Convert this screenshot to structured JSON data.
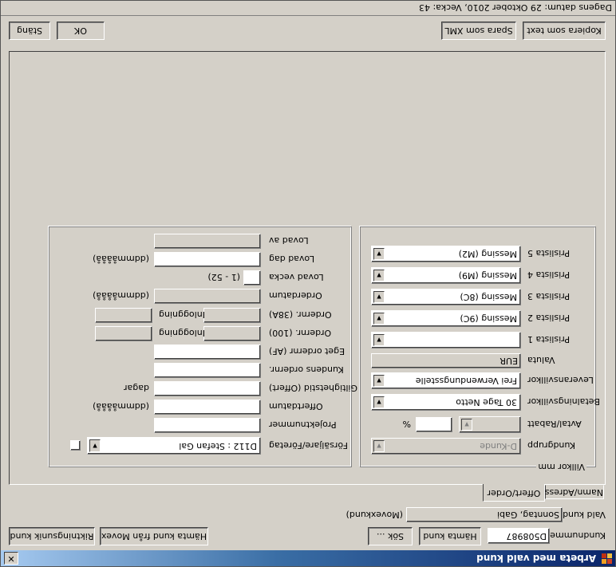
{
  "window": {
    "title": "Arbeta med vald kund",
    "close_glyph": "✕"
  },
  "top": {
    "kundnummer_label": "Kundnummer",
    "kundnummer_value": "D508987",
    "hamta_kund": "Hämta kund",
    "sok": "Sök ...",
    "hamta_movex": "Hämta kund från Movex",
    "riktningsunik": "Riktningsunik kund",
    "vald_kund_label": "Vald kund",
    "vald_kund_value": "Sonntag, Gabi",
    "movexkund": "(Movexkund)"
  },
  "tabs": {
    "namn_adress": "Namn/Adress",
    "offert_order": "Offert/Order"
  },
  "villkor": {
    "legend": "Villkor mm",
    "kundgrupp_label": "Kundgrupp",
    "kundgrupp_value": "D-Kunde",
    "avtal_label": "Avtal/Rabatt",
    "avtal_value": "",
    "percent": "%",
    "betalning_label": "Betalningsvillkor",
    "betalning_value": "30 Tage Netto",
    "leverans_label": "Leveransvillkor",
    "leverans_value": "Frei Verwendungsstelle",
    "valuta_label": "Valuta",
    "valuta_value": "EUR",
    "prislista1_label": "Prislista 1",
    "prislista1_value": "",
    "prislista2_label": "Prislista 2",
    "prislista2_value": "Messing (9C)",
    "prislista3_label": "Prislista 3",
    "prislista3_value": "Messing (8C)",
    "prislista4_label": "Prislista 4",
    "prislista4_value": "Messing (M9)",
    "prislista5_label": "Prislista 5",
    "prislista5_value": "Messing (M2)"
  },
  "order": {
    "forsaljare_label": "Försäljare/Företag",
    "forsaljare_value": "D112 : Stefan Gal",
    "projekt_label": "Projektnummer",
    "projekt_value": "",
    "offertdatum_label": "Offertdatum",
    "offertdatum_value": "",
    "offertdatum_hint": "(ddmmåååå)",
    "giltighet_label": "Giltighetstid (Offert)",
    "giltighet_value": "",
    "giltighet_hint": "dagar",
    "kundens_label": "Kundens ordernr.",
    "kundens_value": "",
    "eget_label": "Eget ordernr (AF)",
    "eget_value": "",
    "ordernr100_label": "Ordernr. (100)",
    "ordernr100_value": "",
    "inloggning1_label": "Inloggning",
    "inloggning1_value": "",
    "ordernr38a_label": "Ordernr. (38A)",
    "ordernr38a_value": "",
    "inloggning2_label": "Inloggning",
    "inloggning2_value": "",
    "orderdatum_label": "Orderdatum",
    "orderdatum_value": "",
    "orderdatum_hint": "(ddmmåååå)",
    "lovad_vecka_label": "Lovad vecka",
    "lovad_vecka_value": "",
    "lovad_vecka_hint": "(1 - 52)",
    "lovad_dag_label": "Lovad dag",
    "lovad_dag_value": "",
    "lovad_dag_hint": "(ddmmåååå)",
    "lovad_av_label": "Lovad av",
    "lovad_av_value": ""
  },
  "bottom": {
    "kopiera": "Kopiera som text",
    "spara": "Spara som XML",
    "ok": "OK",
    "stang": "Stäng"
  },
  "status": {
    "text": "Dagens datum: 29 Oktober 2010, Vecka: 43"
  },
  "colors": {
    "face": "#d4d0c8",
    "title_start": "#0a246a",
    "title_end": "#a6caf0"
  }
}
